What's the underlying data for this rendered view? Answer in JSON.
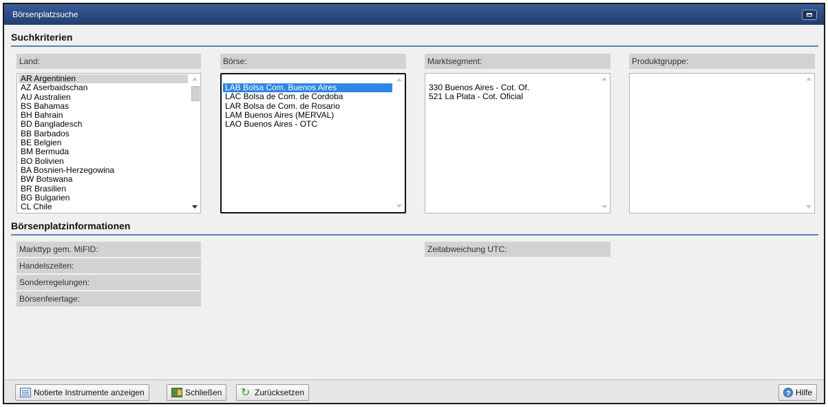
{
  "window": {
    "title": "Börsenplatzsuche"
  },
  "search": {
    "heading": "Suchkriterien",
    "land": {
      "label": "Land:",
      "items": [
        "AR Argentinien",
        "AZ Aserbaidschan",
        "AU Australien",
        "BS Bahamas",
        "BH Bahrain",
        "BD Bangladesch",
        "BB Barbados",
        "BE Belgien",
        "BM Bermuda",
        "BO Bolivien",
        "BA Bosnien-Herzegowina",
        "BW Botswana",
        "BR Brasilien",
        "BG Bulgarien",
        "CL Chile"
      ],
      "selected": "AR Argentinien"
    },
    "boerse": {
      "label": "Börse:",
      "items": [
        "LAB Bolsa Com. Buenos Aires",
        "LAC Bolsa de Com. de Cordoba",
        "LAR Bolsa de Com. de Rosario",
        "LAM Buenos Aires (MERVAL)",
        "LAO Buenos Aires - OTC"
      ],
      "selected": "LAB Bolsa Com. Buenos Aires"
    },
    "marktsegment": {
      "label": "Marktsegment:",
      "items": [
        "330 Buenos Aires - Cot. Of.",
        "521 La Plata - Cot. Oficial"
      ]
    },
    "produktgruppe": {
      "label": "Produktgruppe:",
      "items": []
    }
  },
  "info": {
    "heading": "Börsenplatzinformationen",
    "markttyp_label": "Markttyp gem. MiFID:",
    "handelszeiten_label": "Handelszeiten:",
    "sonderregelungen_label": "Sonderregelungen:",
    "boersenfeiertage_label": "Börsenfeiertage:",
    "zeitabweichung_label": "Zeitabweichung UTC:"
  },
  "footer": {
    "show_instruments_label": "Notierte Instrumente anzeigen",
    "close_label": "Schließen",
    "reset_label": "Zurücksetzen",
    "help_label": "Hilfe"
  }
}
